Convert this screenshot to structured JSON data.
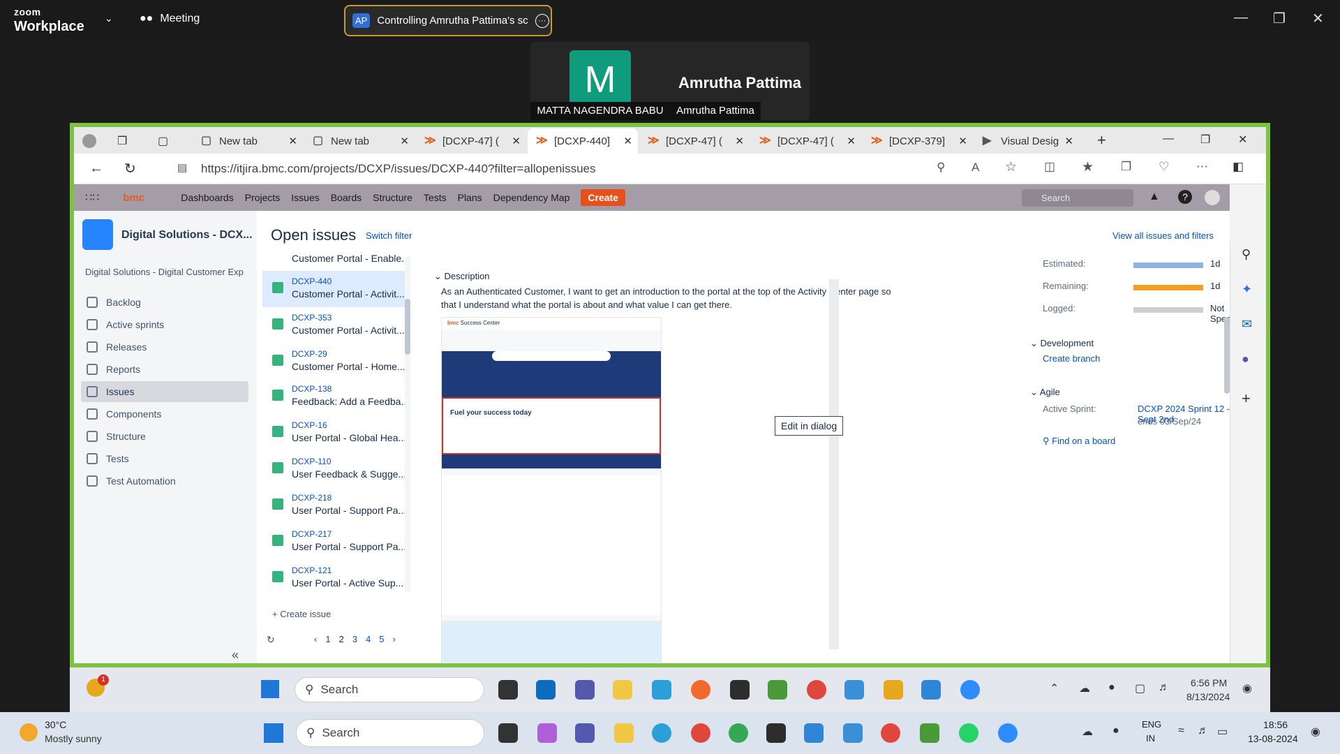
{
  "zoom": {
    "brand_top": "zoom",
    "brand_bottom": "Workplace",
    "meeting_label": "Meeting",
    "control_badge": "AP",
    "control_text": "Controlling Amrutha Pattima's sc",
    "participant_initial": "M",
    "participant_name": "Amrutha Pattima",
    "tile_label_left": "MATTA NAGENDRA BABU",
    "tile_label_right": "Amrutha Pattima"
  },
  "browser": {
    "tabs": [
      {
        "label": "New tab"
      },
      {
        "label": "New tab"
      },
      {
        "label": "[DCXP-47] ("
      },
      {
        "label": "[DCXP-440]"
      },
      {
        "label": "[DCXP-47] ("
      },
      {
        "label": "[DCXP-47] ("
      },
      {
        "label": "[DCXP-379]"
      },
      {
        "label": "Visual Desig"
      }
    ],
    "url": "https://itjira.bmc.com/projects/DCXP/issues/DCXP-440?filter=allopenissues"
  },
  "jira": {
    "logo": "bmc",
    "nav": [
      "Dashboards",
      "Projects",
      "Issues",
      "Boards",
      "Structure",
      "Tests",
      "Plans",
      "Dependency Map"
    ],
    "create_label": "Create",
    "search_placeholder": "Search",
    "project_name": "Digital Solutions - DCX...",
    "project_full": "Digital Solutions - Digital Customer Exp",
    "sidebar": [
      "Backlog",
      "Active sprints",
      "Releases",
      "Reports",
      "Issues",
      "Components",
      "Structure",
      "Tests",
      "Test Automation"
    ],
    "page_title": "Open issues",
    "switch_filter": "Switch filter",
    "view_all": "View all issues and filters",
    "issues": [
      {
        "key": "",
        "summary": "Customer Portal - Enable..."
      },
      {
        "key": "DCXP-440",
        "summary": "Customer Portal - Activit..."
      },
      {
        "key": "DCXP-353",
        "summary": "Customer Portal - Activit..."
      },
      {
        "key": "DCXP-29",
        "summary": "Customer Portal - Home..."
      },
      {
        "key": "DCXP-138",
        "summary": "Feedback: Add a Feedba..."
      },
      {
        "key": "DCXP-16",
        "summary": "User Portal - Global Hea..."
      },
      {
        "key": "DCXP-110",
        "summary": "User Feedback & Sugge..."
      },
      {
        "key": "DCXP-218",
        "summary": "User Portal - Support Pa..."
      },
      {
        "key": "DCXP-217",
        "summary": "User Portal - Support Pa..."
      },
      {
        "key": "DCXP-121",
        "summary": "User Portal - Active Sup..."
      }
    ],
    "create_issue": "+ Create issue",
    "pages": [
      "1",
      "2",
      "3",
      "4",
      "5"
    ],
    "description_heading": "Description",
    "description_text": "As an Authenticated Customer, I want to get an introduction to the portal at the top of the Activity Center page so that I understand what the portal is about and what value I can get there.",
    "edit_tooltip": "Edit in dialog",
    "mock_hero": "Fuel your success today",
    "mock_brand": "Success Center",
    "time": {
      "estimated_label": "Estimated:",
      "estimated_value": "1d",
      "remaining_label": "Remaining:",
      "remaining_value": "1d",
      "logged_label": "Logged:",
      "logged_value": "Not Specified",
      "estimated_color": "#8eb5e0",
      "remaining_color": "#f0a01e",
      "logged_color": "#cfcfcf",
      "estimated_fill": 1,
      "remaining_fill": 1,
      "logged_fill": 1
    },
    "development_heading": "Development",
    "create_branch": "Create branch",
    "agile_heading": "Agile",
    "active_sprint_label": "Active Sprint:",
    "active_sprint_value": "DCXP 2024 Sprint 12 -Sept 2nd",
    "sprint_ends": "ends 03/Sep/24",
    "find_on_board": "Find on a board"
  },
  "taskbar_inner": {
    "badge_count": "1",
    "search_label": "Search",
    "time": "6:56 PM",
    "date": "8/13/2024"
  },
  "taskbar_outer": {
    "temperature": "30°C",
    "weather": "Mostly sunny",
    "search_label": "Search",
    "lang": "ENG",
    "region": "IN",
    "time": "18:56",
    "date": "13-08-2024"
  }
}
